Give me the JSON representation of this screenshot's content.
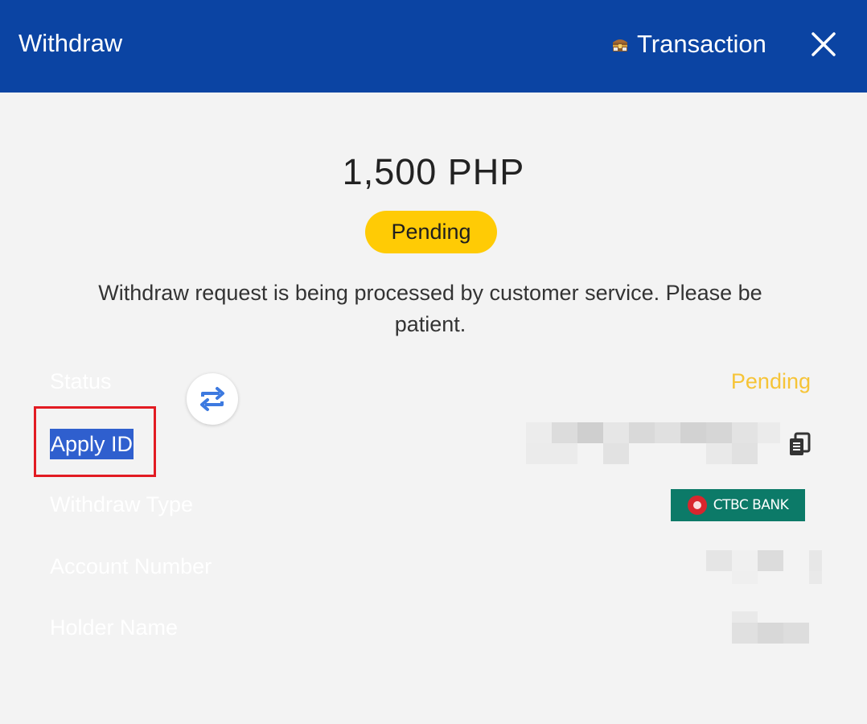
{
  "header": {
    "title": "Withdraw",
    "transaction_label": "Transaction",
    "transaction_icon": "treasure-chest-icon",
    "close_icon": "close-icon",
    "background": "#0b44a3"
  },
  "summary": {
    "amount": "1,500 PHP",
    "status_badge": "Pending",
    "badge_color": "#ffcb05",
    "message": "Withdraw request is being processed by customer service. Please be patient."
  },
  "details": {
    "status_label": "Status",
    "status_value": "Pending",
    "status_color": "#f6c437",
    "apply_id_label": "Apply ID",
    "withdraw_type_label": "Withdraw Type",
    "withdraw_type_bank": "CTBC BANK",
    "account_number_label": "Account Number",
    "holder_name_label": "Holder Name"
  },
  "icons": {
    "swap": "swap-icon",
    "copy": "copy-icon"
  }
}
